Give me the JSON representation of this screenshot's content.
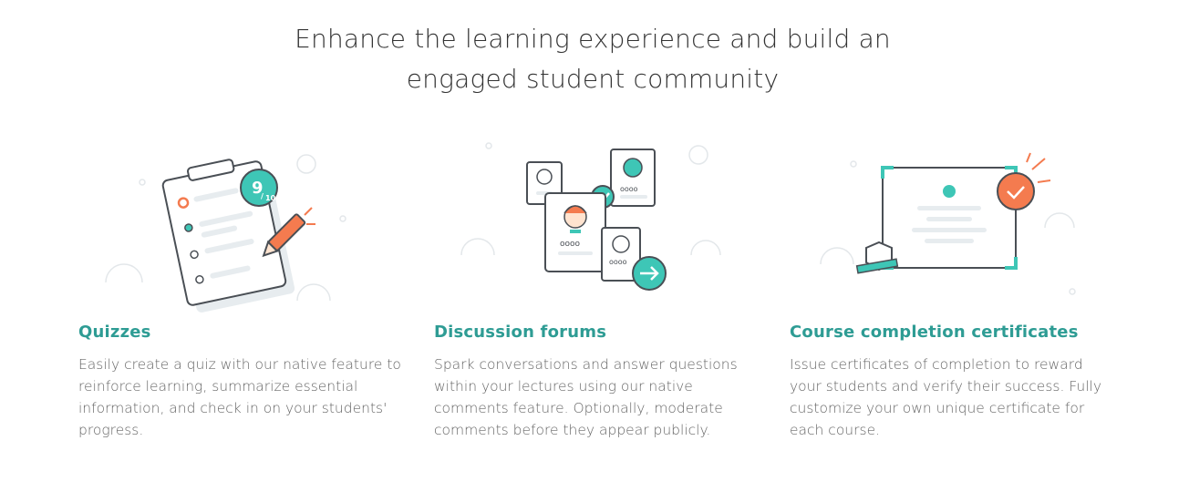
{
  "headline": {
    "line1": "Enhance the learning experience and build an",
    "line2": "engaged student community"
  },
  "features": [
    {
      "title": "Quizzes",
      "description": "Easily create a quiz with our native feature to reinforce learning, summarize essential information, and check in on your students' progress.",
      "illustration": "quiz-clipboard-icon",
      "score_numerator": "9",
      "score_denominator": "10"
    },
    {
      "title": "Discussion forums",
      "description": "Spark conversations and answer questions within your lectures using our native comments feature. Optionally, moderate comments before they appear publicly.",
      "illustration": "discussion-cards-icon"
    },
    {
      "title": "Course completion certificates",
      "description": "Issue certificates of completion to reward your students and verify their success. Fully customize your own unique certificate for each course.",
      "illustration": "certificate-icon"
    }
  ],
  "colors": {
    "accent": "#2e9c94",
    "teal": "#3ec6b6",
    "orange": "#f47b4f",
    "line": "#4a4f55",
    "light": "#e7ecef"
  }
}
